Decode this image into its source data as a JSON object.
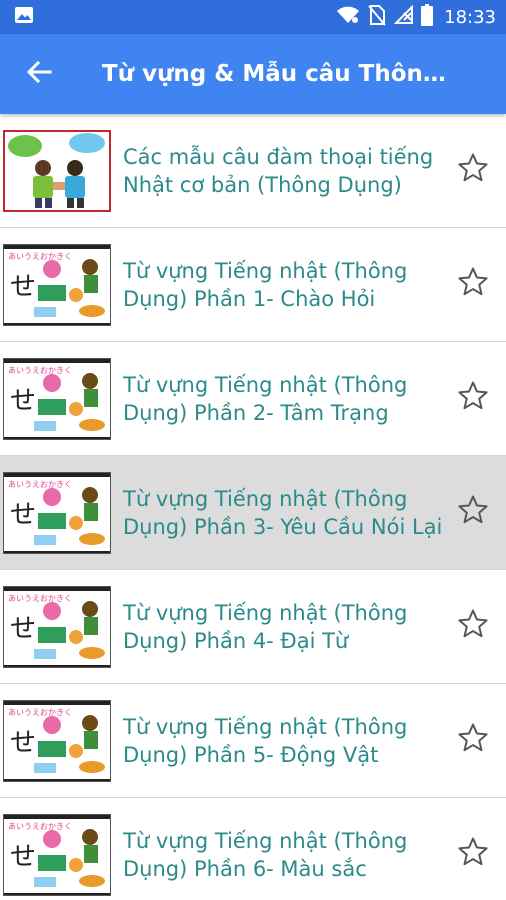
{
  "status_bar": {
    "time": "18:33",
    "icons": [
      "image-icon",
      "wifi-icon",
      "no-sim-icon",
      "no-signal-icon",
      "battery-icon"
    ]
  },
  "app_bar": {
    "title": "Từ vựng & Mẫu câu Thông…",
    "back_icon": "arrow-back-icon"
  },
  "list": {
    "items": [
      {
        "title": "Các mẫu câu đàm thoại tiếng Nhật cơ bản (Thông Dụng)",
        "thumb": "conversation-thumbnail",
        "selected": false
      },
      {
        "title": "Từ vựng Tiếng nhật (Thông Dụng) Phần 1- Chào Hỏi",
        "thumb": "vocabulary-thumbnail",
        "selected": false
      },
      {
        "title": "Từ vựng Tiếng nhật (Thông Dụng) Phần 2- Tâm Trạng",
        "thumb": "vocabulary-thumbnail",
        "selected": false
      },
      {
        "title": "Từ vựng Tiếng nhật (Thông Dụng) Phần 3- Yêu Cầu Nói Lại",
        "thumb": "vocabulary-thumbnail",
        "selected": true
      },
      {
        "title": "Từ vựng Tiếng nhật (Thông Dụng) Phần 4- Đại Từ",
        "thumb": "vocabulary-thumbnail",
        "selected": false
      },
      {
        "title": "Từ vựng Tiếng nhật (Thông Dụng) Phần 5- Động Vật",
        "thumb": "vocabulary-thumbnail",
        "selected": false
      },
      {
        "title": "Từ vựng Tiếng nhật (Thông Dụng) Phần 6- Màu sắc",
        "thumb": "vocabulary-thumbnail",
        "selected": false
      }
    ]
  },
  "colors": {
    "status_bar": "#2f6edb",
    "app_bar": "#3f84f0",
    "item_text": "#2b8a8a",
    "selected_row": "#dcdcdc"
  }
}
